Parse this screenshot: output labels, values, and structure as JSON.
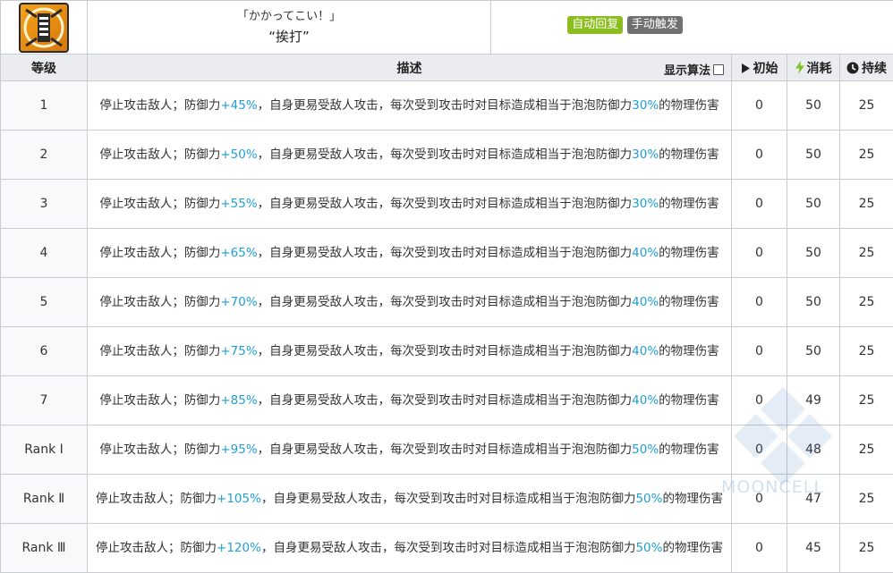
{
  "header": {
    "subtitle": "「かかってこい！」",
    "name": "“挨打”",
    "badge_recovery": "自动回复",
    "badge_trigger": "手动触发"
  },
  "columns": {
    "level": "等级",
    "description": "描述",
    "show_formula": "显示算法",
    "initial": "初始",
    "cost": "消耗",
    "duration": "持续"
  },
  "rows": [
    {
      "level": "1",
      "desc_a": "停止攻击敌人；防御力",
      "def": "+45%",
      "desc_b": "，自身更易受敌人攻击，每次受到攻击时对目标造成相当于泡泡防御力",
      "dmg": "30%",
      "desc_c": "的物理伤害",
      "initial": "0",
      "cost": "50",
      "duration": "25"
    },
    {
      "level": "2",
      "desc_a": "停止攻击敌人；防御力",
      "def": "+50%",
      "desc_b": "，自身更易受敌人攻击，每次受到攻击时对目标造成相当于泡泡防御力",
      "dmg": "30%",
      "desc_c": "的物理伤害",
      "initial": "0",
      "cost": "50",
      "duration": "25"
    },
    {
      "level": "3",
      "desc_a": "停止攻击敌人；防御力",
      "def": "+55%",
      "desc_b": "，自身更易受敌人攻击，每次受到攻击时对目标造成相当于泡泡防御力",
      "dmg": "30%",
      "desc_c": "的物理伤害",
      "initial": "0",
      "cost": "50",
      "duration": "25"
    },
    {
      "level": "4",
      "desc_a": "停止攻击敌人；防御力",
      "def": "+65%",
      "desc_b": "，自身更易受敌人攻击，每次受到攻击时对目标造成相当于泡泡防御力",
      "dmg": "40%",
      "desc_c": "的物理伤害",
      "initial": "0",
      "cost": "50",
      "duration": "25"
    },
    {
      "level": "5",
      "desc_a": "停止攻击敌人；防御力",
      "def": "+70%",
      "desc_b": "，自身更易受敌人攻击，每次受到攻击时对目标造成相当于泡泡防御力",
      "dmg": "40%",
      "desc_c": "的物理伤害",
      "initial": "0",
      "cost": "50",
      "duration": "25"
    },
    {
      "level": "6",
      "desc_a": "停止攻击敌人；防御力",
      "def": "+75%",
      "desc_b": "，自身更易受敌人攻击，每次受到攻击时对目标造成相当于泡泡防御力",
      "dmg": "40%",
      "desc_c": "的物理伤害",
      "initial": "0",
      "cost": "50",
      "duration": "25"
    },
    {
      "level": "7",
      "desc_a": "停止攻击敌人；防御力",
      "def": "+85%",
      "desc_b": "，自身更易受敌人攻击，每次受到攻击时对目标造成相当于泡泡防御力",
      "dmg": "40%",
      "desc_c": "的物理伤害",
      "initial": "0",
      "cost": "49",
      "duration": "25"
    },
    {
      "level": "Rank Ⅰ",
      "desc_a": "停止攻击敌人；防御力",
      "def": "+95%",
      "desc_b": "，自身更易受敌人攻击，每次受到攻击时对目标造成相当于泡泡防御力",
      "dmg": "50%",
      "desc_c": "的物理伤害",
      "initial": "0",
      "cost": "48",
      "duration": "25"
    },
    {
      "level": "Rank Ⅱ",
      "desc_a": "停止攻击敌人；防御力",
      "def": "+105%",
      "desc_b": "，自身更易受敌人攻击，每次受到攻击时对目标造成相当于泡泡防御力",
      "dmg": "50%",
      "desc_c": "的物理伤害",
      "initial": "0",
      "cost": "47",
      "duration": "25"
    },
    {
      "level": "Rank Ⅲ",
      "desc_a": "停止攻击敌人；防御力",
      "def": "+120%",
      "desc_b": "，自身更易受敌人攻击，每次受到攻击时对目标造成相当于泡泡防御力",
      "dmg": "50%",
      "desc_c": "的物理伤害",
      "initial": "0",
      "cost": "45",
      "duration": "25"
    }
  ],
  "watermark": "MOONCELL",
  "icons": {
    "skill": "skill-icon",
    "initial": "play-icon",
    "cost": "lightning-icon",
    "duration": "clock-icon"
  },
  "colors": {
    "highlight": "#1f9fd6",
    "badge_recovery": "#8bbd1e",
    "badge_trigger": "#707070",
    "cost_icon": "#7cc41b"
  }
}
